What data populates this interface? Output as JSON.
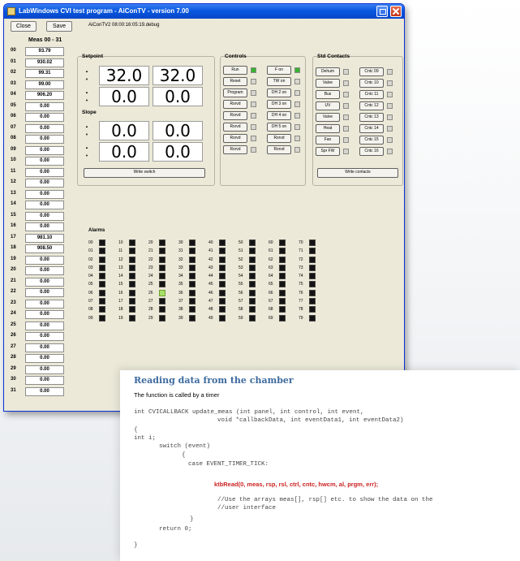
{
  "window": {
    "title": "LabWindows CVI test program - AiConTV - version 7.00",
    "close_label": "Close",
    "save_label": "Save",
    "status": "AiConTV2 08:00:16:05:19.debug"
  },
  "meas": {
    "header": "Meas 00 - 31",
    "rows": [
      {
        "label": "00",
        "value": "93.79"
      },
      {
        "label": "01",
        "value": "930.02"
      },
      {
        "label": "02",
        "value": "99.31"
      },
      {
        "label": "03",
        "value": "99.00"
      },
      {
        "label": "04",
        "value": "906.20"
      },
      {
        "label": "05",
        "value": "0.00"
      },
      {
        "label": "06",
        "value": "0.00"
      },
      {
        "label": "07",
        "value": "0.00"
      },
      {
        "label": "08",
        "value": "0.00"
      },
      {
        "label": "09",
        "value": "0.00"
      },
      {
        "label": "10",
        "value": "0.00"
      },
      {
        "label": "11",
        "value": "0.00"
      },
      {
        "label": "12",
        "value": "0.00"
      },
      {
        "label": "13",
        "value": "0.00"
      },
      {
        "label": "14",
        "value": "0.00"
      },
      {
        "label": "15",
        "value": "0.00"
      },
      {
        "label": "16",
        "value": "0.00"
      },
      {
        "label": "17",
        "value": "981.10"
      },
      {
        "label": "18",
        "value": "908.50"
      },
      {
        "label": "19",
        "value": "0.00"
      },
      {
        "label": "20",
        "value": "0.00"
      },
      {
        "label": "21",
        "value": "0.00"
      },
      {
        "label": "22",
        "value": "0.00"
      },
      {
        "label": "23",
        "value": "0.00"
      },
      {
        "label": "24",
        "value": "0.00"
      },
      {
        "label": "25",
        "value": "0.00"
      },
      {
        "label": "26",
        "value": "0.00"
      },
      {
        "label": "27",
        "value": "0.00"
      },
      {
        "label": "28",
        "value": "0.00"
      },
      {
        "label": "29",
        "value": "0.00"
      },
      {
        "label": "30",
        "value": "0.00"
      },
      {
        "label": "31",
        "value": "0.00"
      }
    ]
  },
  "setpoint": {
    "title": "Setpoint",
    "values": [
      "32.0",
      "32.0",
      "0.0",
      "0.0"
    ]
  },
  "slope": {
    "title": "Slope",
    "values": [
      "0.0",
      "0.0",
      "0.0",
      "0.0"
    ]
  },
  "write_switch_label": "Write switch",
  "controls": {
    "title": "Controls",
    "col1": [
      "Run",
      "Reset",
      "Program",
      "Rsrvd",
      "Rsrvd",
      "Rsrvd",
      "Rsrvd",
      "Rsrvd"
    ],
    "col2": [
      "F on",
      "TW on",
      "DH 2 on",
      "DH 3 on",
      "DH 4 on",
      "DH 5 on",
      "Rsrvd",
      "Rsrvd"
    ]
  },
  "contacts": {
    "title": "Std Contacts",
    "col1": [
      "Dehum",
      "Valve",
      "Bus",
      "UV",
      "Valve",
      "Heat",
      "Fan",
      "Spr FW"
    ],
    "col2": [
      "Cntc 09",
      "Cntc 10",
      "Cntc 11",
      "Cntc 12",
      "Cntc 13",
      "Cntc 14",
      "Cntc 15",
      "Cntc 16"
    ],
    "write_label": "Write contacts"
  },
  "alarms": {
    "title": "Alarms",
    "columns": [
      [
        "00",
        "01",
        "02",
        "03",
        "04",
        "05",
        "06",
        "07",
        "08",
        "09"
      ],
      [
        "10",
        "11",
        "12",
        "13",
        "14",
        "15",
        "16",
        "17",
        "18",
        "19"
      ],
      [
        "20",
        "21",
        "22",
        "23",
        "24",
        "25",
        "26",
        "27",
        "28",
        "29"
      ],
      [
        "30",
        "31",
        "32",
        "33",
        "34",
        "35",
        "36",
        "37",
        "38",
        "39"
      ],
      [
        "40",
        "41",
        "42",
        "43",
        "44",
        "45",
        "46",
        "47",
        "48",
        "49"
      ],
      [
        "50",
        "51",
        "52",
        "53",
        "54",
        "55",
        "56",
        "57",
        "58",
        "59"
      ],
      [
        "60",
        "61",
        "62",
        "63",
        "64",
        "65",
        "66",
        "67",
        "68",
        "69"
      ],
      [
        "70",
        "71",
        "72",
        "73",
        "74",
        "75",
        "76",
        "77",
        "78",
        "79"
      ]
    ],
    "active": [
      "26"
    ]
  },
  "code": {
    "title": "Reading data from the chamber",
    "subtitle": "The function is called by a timer",
    "lines": [
      "int CVICALLBACK update_meas (int panel, int control, int event,",
      "void *callbackData, int eventData1, int eventData2)",
      "{",
      "int i;",
      "switch (event)",
      "{",
      "case EVENT_TIMER_TICK:",
      "ktbRead(0, meas, rsp, rsl, ctrl, cntc, hwcm, al, prgm, err);",
      "//Use the arrays meas[], rsp[] etc. to show the data on the",
      "//user interface",
      "}",
      "return 0;",
      "}"
    ]
  }
}
